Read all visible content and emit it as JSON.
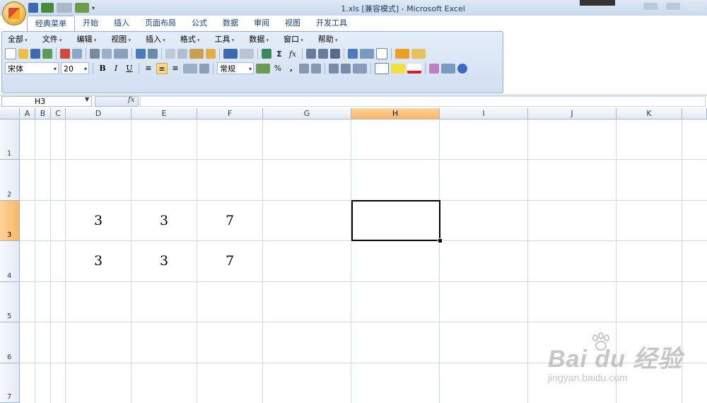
{
  "window": {
    "title": "1.xls  [兼容模式] - Microsoft Excel"
  },
  "ribbon_tabs": [
    "经典菜单",
    "开始",
    "插入",
    "页面布局",
    "公式",
    "数据",
    "审阅",
    "视图",
    "开发工具"
  ],
  "classic_menu": [
    "全部",
    "文件",
    "编辑",
    "视图",
    "插入",
    "格式",
    "工具",
    "数据",
    "窗口",
    "帮助"
  ],
  "format": {
    "font_name": "宋体",
    "font_size": "20",
    "bold": "B",
    "italic": "I",
    "underline": "U",
    "number_format": "常规",
    "percent": "%",
    "comma": ",",
    "fx": "fx",
    "sigma": "Σ"
  },
  "formula_bar": {
    "name_box": "H3",
    "fx_label": "fx",
    "content": ""
  },
  "columns": [
    "A",
    "B",
    "C",
    "D",
    "E",
    "F",
    "G",
    "H",
    "I",
    "J",
    "K"
  ],
  "rows": [
    "1",
    "2",
    "3",
    "4",
    "5",
    "6",
    "7"
  ],
  "selected_cell": {
    "column": "H",
    "row": "3"
  },
  "cells": {
    "D3": "3",
    "E3": "3",
    "F3": "7",
    "D4": "3",
    "E4": "3",
    "F4": "7"
  },
  "watermark": {
    "logo": "Bai du 经验",
    "url": "jingyan.baidu.com"
  },
  "colors": {
    "selected_header": "#f9b665",
    "grid_line": "#d0d7e5",
    "ribbon_border": "#8db2e3"
  }
}
